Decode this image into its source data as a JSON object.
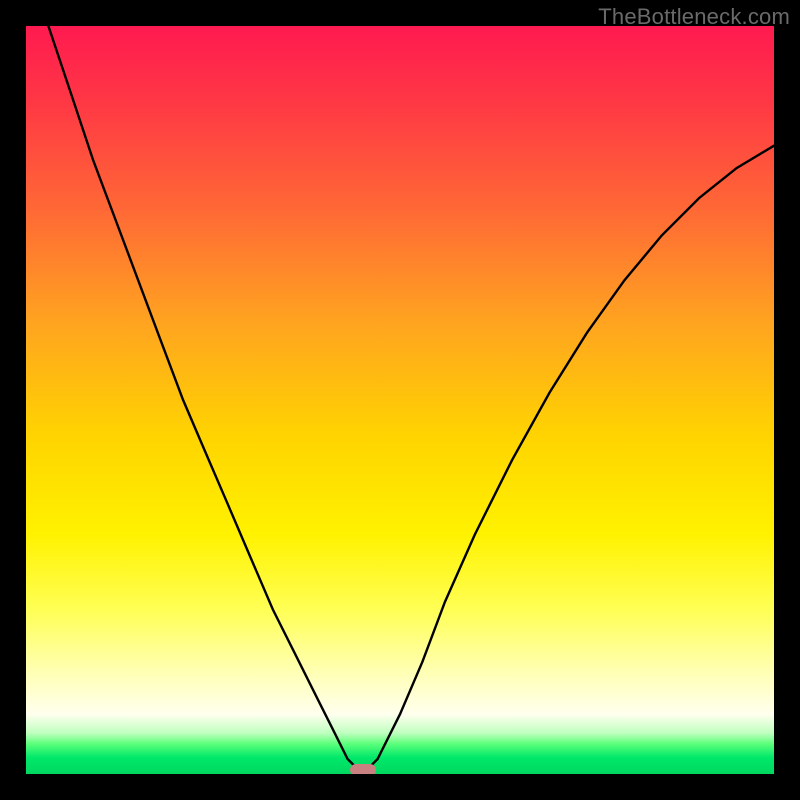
{
  "watermark": "TheBottleneck.com",
  "chart_data": {
    "type": "line",
    "title": "",
    "xlabel": "",
    "ylabel": "",
    "xlim": [
      0,
      1
    ],
    "ylim": [
      0,
      1
    ],
    "minimum_x": 0.45,
    "series": [
      {
        "name": "curve",
        "x": [
          0.0,
          0.03,
          0.06,
          0.09,
          0.12,
          0.15,
          0.18,
          0.21,
          0.24,
          0.27,
          0.3,
          0.33,
          0.36,
          0.39,
          0.41,
          0.43,
          0.45,
          0.47,
          0.5,
          0.53,
          0.56,
          0.6,
          0.65,
          0.7,
          0.75,
          0.8,
          0.85,
          0.9,
          0.95,
          1.0
        ],
        "y": [
          1.1,
          1.0,
          0.91,
          0.82,
          0.74,
          0.66,
          0.58,
          0.5,
          0.43,
          0.36,
          0.29,
          0.22,
          0.16,
          0.1,
          0.06,
          0.02,
          0.0,
          0.02,
          0.08,
          0.15,
          0.23,
          0.32,
          0.42,
          0.51,
          0.59,
          0.66,
          0.72,
          0.77,
          0.81,
          0.84
        ]
      }
    ],
    "gradient_stops": [
      {
        "pos": 0.0,
        "color": "#ff1a50"
      },
      {
        "pos": 0.55,
        "color": "#ffd400"
      },
      {
        "pos": 0.96,
        "color": "#5aff7a"
      },
      {
        "pos": 1.0,
        "color": "#00d860"
      }
    ],
    "marker": {
      "x": 0.45,
      "y": 0.0,
      "color": "#c98080"
    }
  }
}
